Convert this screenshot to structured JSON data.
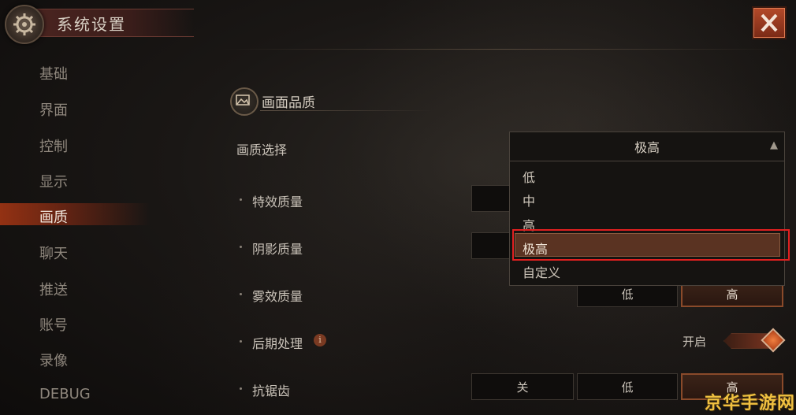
{
  "header": {
    "title": "系统设置"
  },
  "sidebar": {
    "items": [
      {
        "label": "基础"
      },
      {
        "label": "界面"
      },
      {
        "label": "控制"
      },
      {
        "label": "显示"
      },
      {
        "label": "画质"
      },
      {
        "label": "聊天"
      },
      {
        "label": "推送"
      },
      {
        "label": "账号"
      },
      {
        "label": "录像"
      },
      {
        "label": "DEBUG"
      }
    ],
    "active_index": 4
  },
  "section": {
    "title": "画面品质"
  },
  "quality_select": {
    "label": "画质选择",
    "value": "极高",
    "options": [
      "低",
      "中",
      "高",
      "极高",
      "自定义"
    ],
    "selected": "极高"
  },
  "rows": {
    "effects": {
      "label": "特效质量"
    },
    "shadow": {
      "label": "阴影质量"
    },
    "fog": {
      "label": "雾效质量",
      "options": [
        "低",
        "高"
      ],
      "selected": "高"
    },
    "post": {
      "label": "后期处理",
      "toggle_label": "开启",
      "toggle_on": true
    },
    "aa": {
      "label": "抗锯齿",
      "options": [
        "关",
        "低",
        "高"
      ],
      "selected": "高"
    }
  },
  "watermark": "京华手游网",
  "colors": {
    "accent": "#b04018",
    "highlight": "#e02020"
  }
}
